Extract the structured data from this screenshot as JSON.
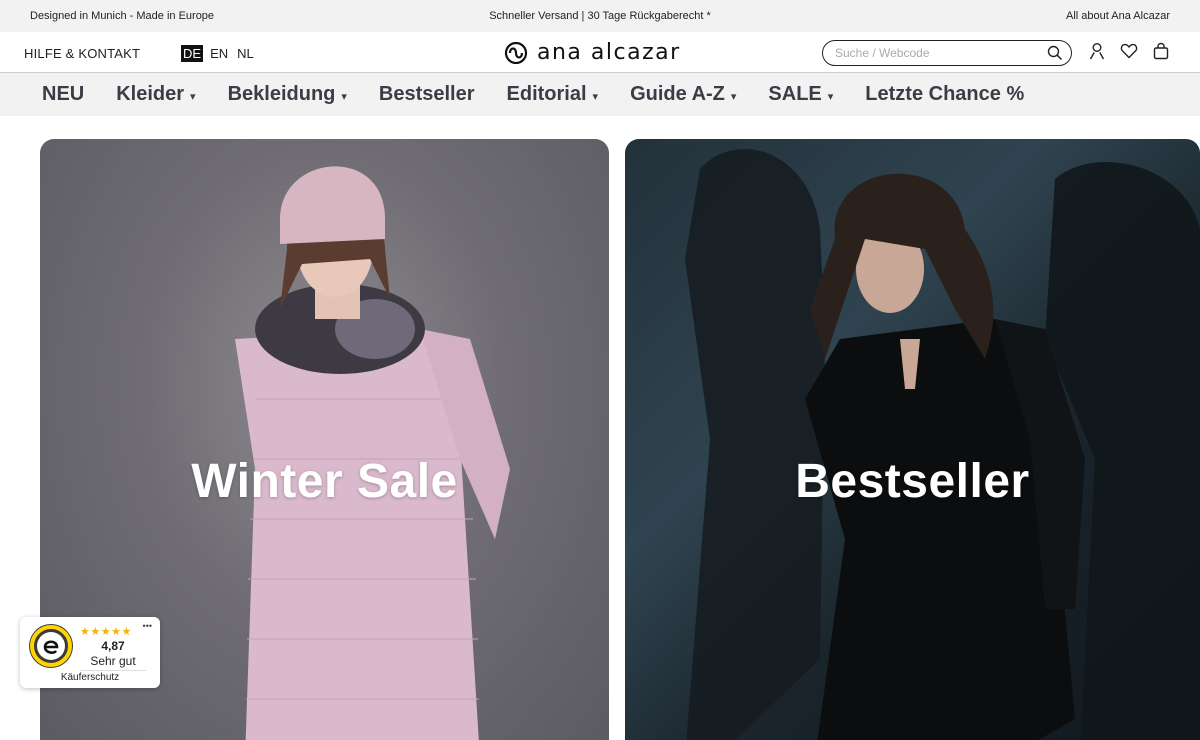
{
  "topbar": {
    "left": "Designed in Munich - Made in Europe",
    "center": "Schneller Versand | 30 Tage Rückgaberecht *",
    "right": "All about Ana Alcazar"
  },
  "header": {
    "help": "HILFE & KONTAKT",
    "languages": [
      "DE",
      "EN",
      "NL"
    ],
    "active_language": "DE",
    "logo_text": "ana alcazar",
    "search_placeholder": "Suche / Webcode",
    "icons": [
      "search-icon",
      "account-icon",
      "wishlist-heart-icon",
      "shopping-bag-icon"
    ]
  },
  "nav": {
    "items": [
      {
        "label": "NEU",
        "has_dropdown": false
      },
      {
        "label": "Kleider",
        "has_dropdown": true
      },
      {
        "label": "Bekleidung",
        "has_dropdown": true
      },
      {
        "label": "Bestseller",
        "has_dropdown": false
      },
      {
        "label": "Editorial",
        "has_dropdown": true
      },
      {
        "label": "Guide A-Z",
        "has_dropdown": true
      },
      {
        "label": "SALE",
        "has_dropdown": true
      },
      {
        "label": "Letzte Chance %",
        "has_dropdown": false
      }
    ],
    "caret": "▾"
  },
  "hero": {
    "cards": [
      {
        "title": "Winter Sale"
      },
      {
        "title": "Bestseller"
      }
    ]
  },
  "trust_badge": {
    "stars": "★★★★★",
    "more": "•••",
    "score": "4,87",
    "rating": "Sehr gut",
    "protection": "Käuferschutz"
  },
  "colors": {
    "nav_text": "#3a3d45",
    "nav_bg": "#f2f2f2",
    "star": "#f5b300"
  }
}
